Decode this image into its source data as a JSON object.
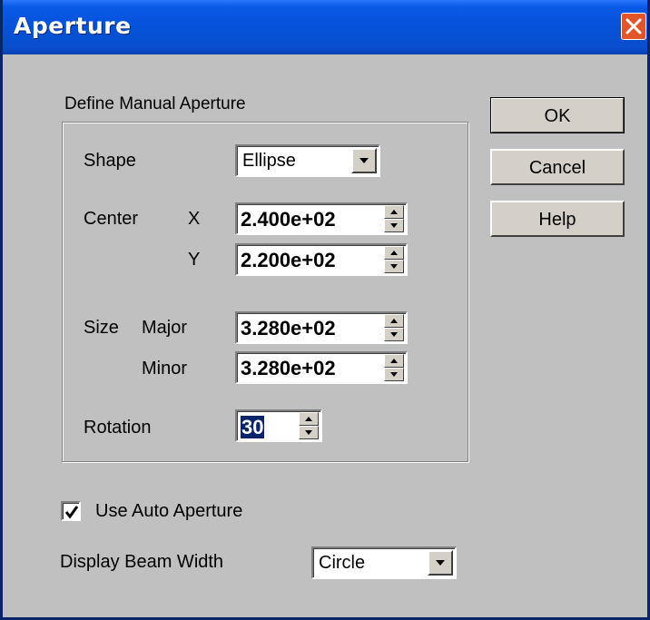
{
  "window": {
    "title": "Aperture"
  },
  "group": {
    "label": "Define Manual Aperture"
  },
  "shape": {
    "label": "Shape",
    "value": "Ellipse"
  },
  "center": {
    "label": "Center",
    "x_label": "X",
    "x_value": "2.400e+02",
    "y_label": "Y",
    "y_value": "2.200e+02"
  },
  "size": {
    "label": "Size",
    "major_label": "Major",
    "major_value": "3.280e+02",
    "minor_label": "Minor",
    "minor_value": "3.280e+02"
  },
  "rotation": {
    "label": "Rotation",
    "value": "30"
  },
  "buttons": {
    "ok": "OK",
    "cancel": "Cancel",
    "help": "Help"
  },
  "auto_aperture": {
    "label": "Use Auto Aperture",
    "checked": true
  },
  "beam_width": {
    "label": "Display Beam Width",
    "value": "Circle"
  },
  "colors": {
    "titlebar": "#0552d8",
    "face": "#c0c0c0",
    "close": "#e0552a",
    "selection": "#0a246a"
  },
  "icons": {
    "close": "close-icon",
    "dropdown": "chevron-down-icon",
    "spin_up": "spin-up-icon",
    "spin_down": "spin-down-icon",
    "check": "checkmark-icon"
  }
}
